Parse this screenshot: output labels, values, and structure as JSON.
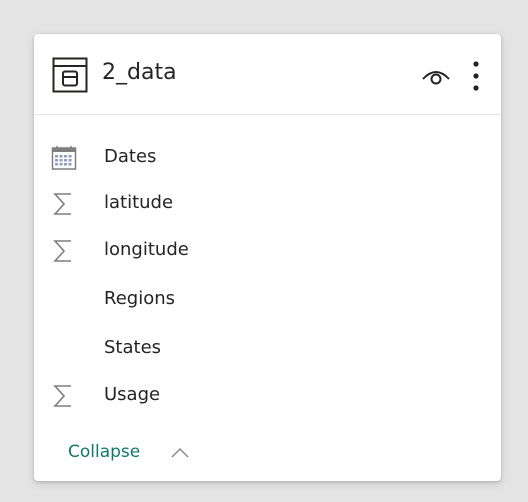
{
  "table": {
    "name": "2_data",
    "icons": {
      "table": "table-icon",
      "visibility": "eye-icon",
      "more": "more-options-icon"
    }
  },
  "fields": [
    {
      "label": "Dates",
      "icon": "calendar-icon"
    },
    {
      "label": "latitude",
      "icon": "sigma-icon"
    },
    {
      "label": "longitude",
      "icon": "sigma-icon"
    },
    {
      "label": "Regions",
      "icon": ""
    },
    {
      "label": "States",
      "icon": ""
    },
    {
      "label": "Usage",
      "icon": "sigma-icon"
    }
  ],
  "footer": {
    "collapse_label": "Collapse",
    "collapse_icon": "chevron-up-icon"
  },
  "colors": {
    "link": "#117865",
    "text": "#252423",
    "background": "#e4e4e4",
    "card": "#ffffff"
  }
}
